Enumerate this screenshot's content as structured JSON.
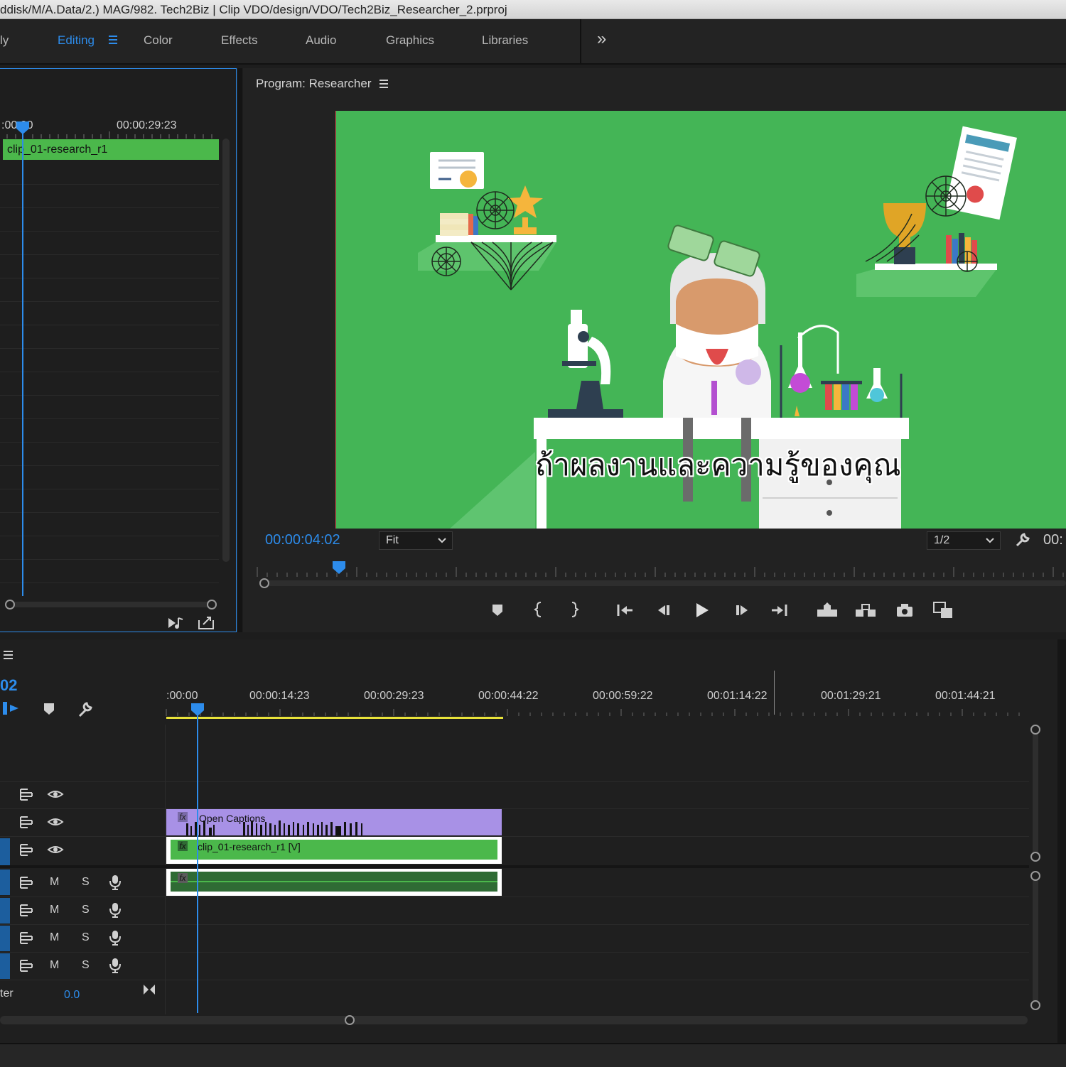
{
  "window": {
    "title": "ddisk/M/A.Data/2.) MAG/982. Tech2Biz | Clip VDO/design/VDO/Tech2Biz_Researcher_2.prproj"
  },
  "workspaces": {
    "tabs": [
      "ly",
      "Editing",
      "Color",
      "Effects",
      "Audio",
      "Graphics",
      "Libraries"
    ],
    "active": "Editing",
    "more_glyph": "»"
  },
  "source_monitor": {
    "timecode_start": ":00:00",
    "timecode_end": "00:00:29:23",
    "clip_name": "clip_01-research_r1"
  },
  "program_monitor": {
    "title": "Program: Researcher",
    "current_timecode": "00:00:04:02",
    "zoom": "Fit",
    "resolution": "1/2",
    "duration_partial": "00:",
    "subtitle": "ถ้าผลงานและความรู้ของคุณ"
  },
  "timeline": {
    "current_timecode_partial": "02",
    "ruler_labels": [
      ":00:00",
      "00:00:14:23",
      "00:00:29:23",
      "00:00:44:22",
      "00:00:59:22",
      "00:01:14:22",
      "00:01:29:21",
      "00:01:44:21"
    ],
    "video_tracks": [
      {
        "icon": "track-lock-icon",
        "visibility": "eye-icon"
      },
      {
        "icon": "track-lock-icon",
        "visibility": "eye-icon"
      },
      {
        "icon": "track-lock-icon",
        "visibility": "eye-icon"
      }
    ],
    "audio_tracks": [
      {
        "mute": "M",
        "solo": "S"
      },
      {
        "mute": "M",
        "solo": "S"
      },
      {
        "mute": "M",
        "solo": "S"
      },
      {
        "mute": "M",
        "solo": "S"
      }
    ],
    "master_label": "ter",
    "master_value": "0.0",
    "captions_clip_label": "Open Captions",
    "video_clip_label": "clip_01-research_r1 [V]",
    "fx_badge": "fx"
  },
  "colors": {
    "accent_blue": "#2d8ceb",
    "video_clip_green": "#4bb84b",
    "caption_clip_purple": "#a891e6",
    "audio_clip_green": "#2f6b34",
    "preview_background": "#44b556",
    "work_area_yellow": "#e8e23a"
  }
}
